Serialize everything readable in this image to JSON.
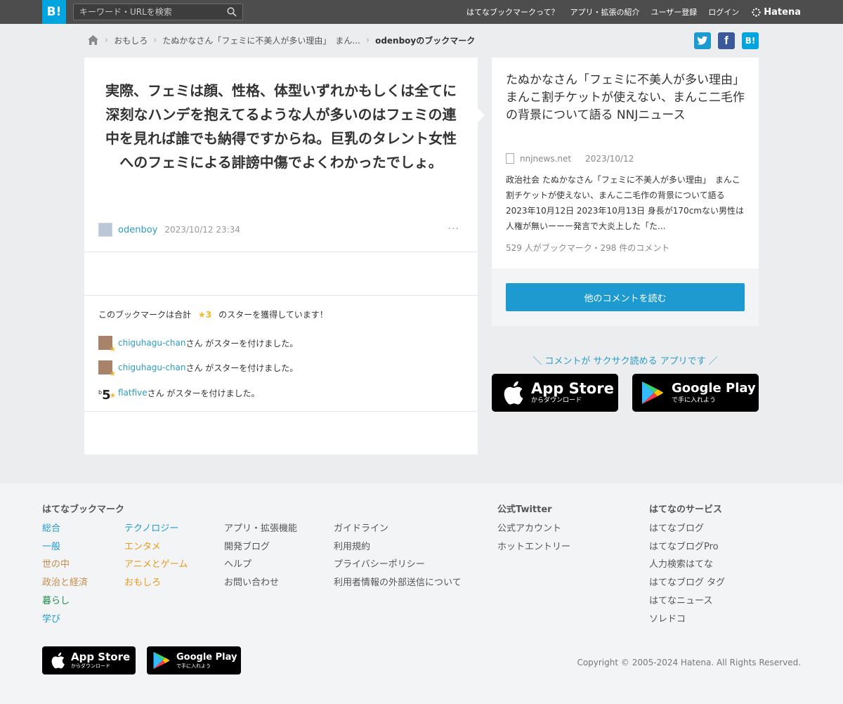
{
  "header": {
    "logo": "B!",
    "search_placeholder": "キーワード・URLを検索",
    "nav": [
      "はてなブックマークって？",
      "アプリ・拡張の紹介",
      "ユーザー登録",
      "ログイン"
    ],
    "brand": "Hatena"
  },
  "breadcrumb": {
    "items": [
      "おもしろ",
      "たぬかなさん「フェミに不美人が多い理由」　まん..."
    ],
    "current": "odenboyのブックマーク"
  },
  "share": {
    "twitter": "t",
    "facebook": "f",
    "hatena": "B!"
  },
  "bookmark": {
    "comment": "実際、フェミは顔、性格、体型いずれかもしくは全てに深刻なハンデを抱えてるような人が多いのはフェミの連中を見れば誰でも納得ですからね。巨乳のタレント女性へのフェミによる誹謗中傷でよくわかったでしょ。",
    "user": "odenboy",
    "timestamp": "2023/10/12 23:34",
    "more": "···"
  },
  "stars": {
    "prefix": "このブックマークは合計",
    "count": "★3",
    "suffix": "のスターを獲得しています！",
    "list": [
      {
        "user": "chiguhagu-chan",
        "text": "さん がスターを付けました。"
      },
      {
        "user": "chiguhagu-chan",
        "text": "さん がスターを付けました。"
      },
      {
        "user": "flatfive",
        "text": "さん がスターを付けました。",
        "avatar": "5",
        "avatar_sup": "b"
      }
    ]
  },
  "entry": {
    "title": "たぬかなさん「フェミに不美人が多い理由」　まんこ割チケットが使えない、まんこ二毛作の背景について語る NNJニュース",
    "domain": "nnjnews.net",
    "date": "2023/10/12",
    "description": "政治社会 たぬかなさん「フェミに不美人が多い理由」　まんこ割チケットが使えない、まんこ二毛作の背景について語る 2023年10月12日 2023年10月13日 身長が170cmない男性は人権が無いーーー発言で大炎上した「た...",
    "count": "529 人がブックマーク・298 件のコメント",
    "read_button": "他のコメントを読む"
  },
  "promo": {
    "text": "＼ コメントが サクサク読める アプリです ／",
    "appstore_big": "App Store",
    "appstore_small": "からダウンロード",
    "googleplay_big": "Google Play",
    "googleplay_small": "で手に入れよう"
  },
  "footer": {
    "bookmark_heading": "はてなブックマーク",
    "col1": [
      "総合",
      "一般",
      "世の中",
      "政治と経済",
      "暮らし",
      "学び"
    ],
    "col2": [
      "テクノロジー",
      "エンタメ",
      "アニメとゲーム",
      "おもしろ"
    ],
    "col3": [
      "アプリ・拡張機能",
      "開発ブログ",
      "ヘルプ",
      "お問い合わせ"
    ],
    "col4": [
      "ガイドライン",
      "利用規約",
      "プライバシーポリシー",
      "利用者情報の外部送信について"
    ],
    "twitter_heading": "公式Twitter",
    "twitter": [
      "公式アカウント",
      "ホットエントリー"
    ],
    "services_heading": "はてなのサービス",
    "services": [
      "はてなブログ",
      "はてなブログPro",
      "人力検索はてな",
      "はてなブログ タグ",
      "はてなニュース",
      "ソレドコ"
    ],
    "copyright": "Copyright © 2005-2024 Hatena. All Rights Reserved.",
    "category_colors": {
      "総合": "#1d9bd1",
      "一般": "#1d9bd1",
      "世の中": "#c48c4a",
      "政治と経済": "#c48c4a",
      "暮らし": "#1e8a4a",
      "学び": "#1d9bd1",
      "テクノロジー": "#1d9bd1",
      "エンタメ": "#e89a1a",
      "アニメとゲーム": "#e89a1a",
      "おもしろ": "#e89a1a"
    }
  },
  "colors": {
    "accent": "#00a4de",
    "link": "#2b9cc4",
    "star": "#f5b62a",
    "twitter": "#1d9bd1",
    "facebook": "#3b5998"
  }
}
